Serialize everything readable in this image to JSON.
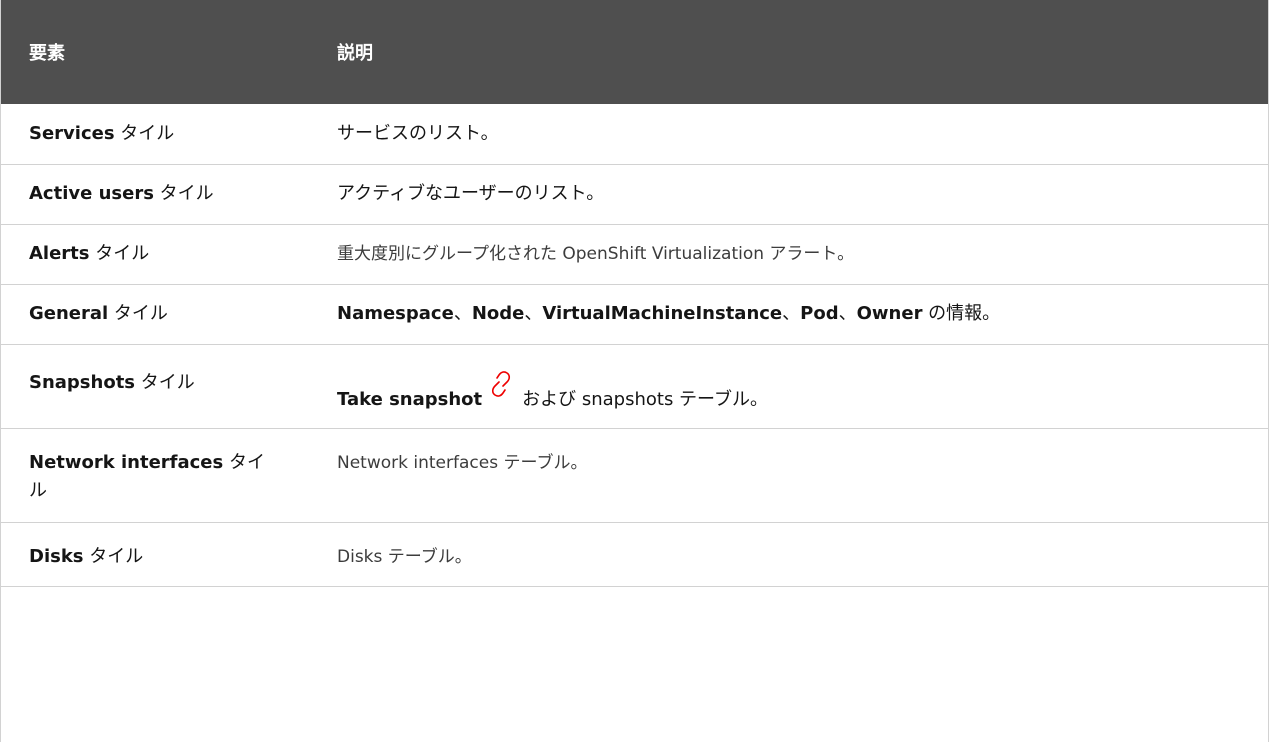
{
  "table": {
    "headers": {
      "element": "要素",
      "description": "説明"
    },
    "rows": [
      {
        "name_en": "Services",
        "name_jp": " タイル",
        "description": "サービスのリスト。"
      },
      {
        "name_en": "Active users",
        "name_jp": " タイル",
        "description": "アクティブなユーザーのリスト。"
      },
      {
        "name_en": "Alerts",
        "name_jp": " タイル",
        "description": "重大度別にグループ化された OpenShift Virtualization アラート。"
      },
      {
        "name_en": "General",
        "name_jp": " タイル",
        "desc_parts": {
          "namespace": "Namespace",
          "sep1": "、",
          "node": "Node",
          "sep2": "、",
          "vmi": "VirtualMachineInstance",
          "sep3": "、",
          "pod": "Pod",
          "sep4": "、",
          "owner": "Owner",
          "tail": " の情報。"
        }
      },
      {
        "name_en": "Snapshots",
        "name_jp": " タイル",
        "desc_parts": {
          "take": "Take snapshot",
          "tail": "および snapshots テーブル。"
        },
        "icon": "link-icon",
        "icon_color": "#ee0000"
      },
      {
        "name_en": "Network interfaces",
        "name_jp": " タイル",
        "description": "Network interfaces テーブル。"
      },
      {
        "name_en": "Disks",
        "name_jp": " タイル",
        "description": "Disks テーブル。"
      }
    ]
  },
  "colors": {
    "header_bg": "#4f4f4f",
    "header_text": "#ffffff",
    "border": "#d2d2d2",
    "icon": "#ee0000"
  }
}
